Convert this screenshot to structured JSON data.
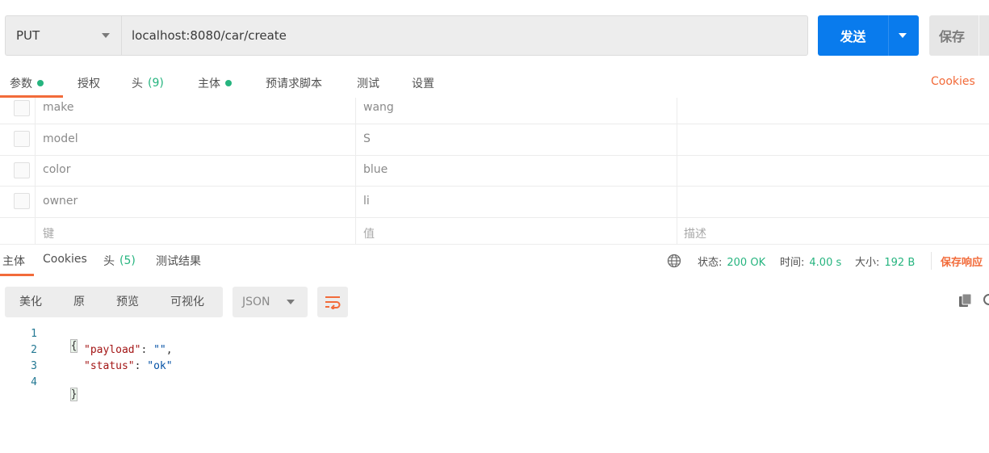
{
  "request": {
    "method": "PUT",
    "url": "localhost:8080/car/create",
    "send_label": "发送",
    "save_label": "保存"
  },
  "request_tabs": [
    {
      "label": "参数",
      "dot": true
    },
    {
      "label": "授权"
    },
    {
      "label": "头",
      "count": "(9)"
    },
    {
      "label": "主体",
      "dot": true
    },
    {
      "label": "预请求脚本"
    },
    {
      "label": "测试"
    },
    {
      "label": "设置"
    }
  ],
  "cookies_label": "Cookies",
  "params": {
    "rows": [
      {
        "key": "make",
        "value": "wang"
      },
      {
        "key": "model",
        "value": "S"
      },
      {
        "key": "color",
        "value": "blue"
      },
      {
        "key": "owner",
        "value": "li"
      }
    ],
    "placeholder": {
      "key": "键",
      "value": "值",
      "description": "描述"
    }
  },
  "response": {
    "tabs": [
      {
        "label": "主体"
      },
      {
        "label": "Cookies"
      },
      {
        "label": "头",
        "count": "(5)"
      },
      {
        "label": "测试结果"
      }
    ],
    "status_label": "状态:",
    "status_value": "200 OK",
    "time_label": "时间:",
    "time_value": "4.00 s",
    "size_label": "大小:",
    "size_value": "192 B",
    "save_label": "保存响应",
    "views": [
      "美化",
      "原",
      "预览",
      "可视化"
    ],
    "format": "JSON",
    "code_lines": [
      {
        "num": "1",
        "text": "{"
      },
      {
        "num": "2",
        "key": "\"payload\"",
        "sep": ": ",
        "value": "\"\"",
        "tail": ","
      },
      {
        "num": "3",
        "key": "\"status\"",
        "sep": ": ",
        "value": "\"ok\"",
        "tail": ""
      },
      {
        "num": "4",
        "text": "}"
      }
    ]
  },
  "colors": {
    "accent": "#f26b3a",
    "primary": "#097bed",
    "success": "#26b47f"
  }
}
